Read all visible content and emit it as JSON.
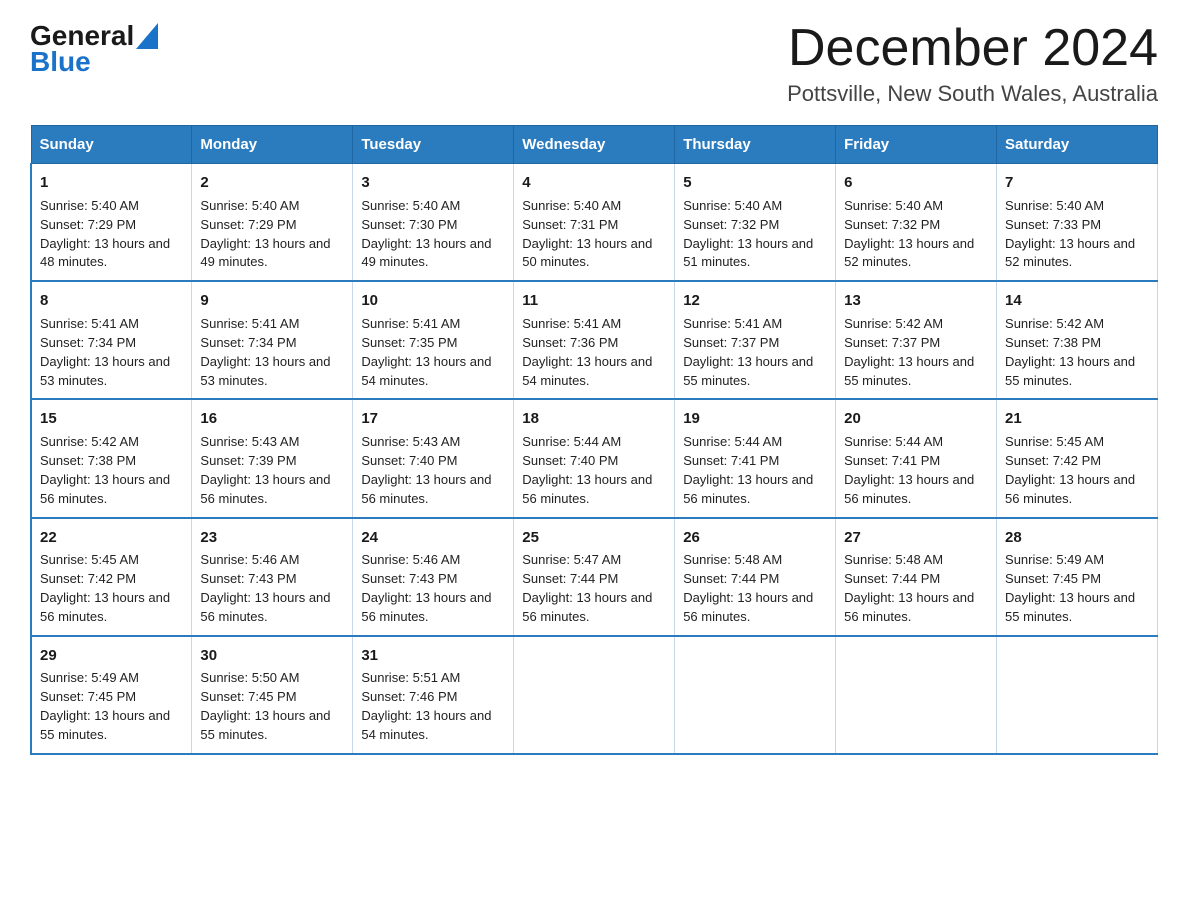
{
  "header": {
    "logo_general": "General",
    "logo_blue": "Blue",
    "title": "December 2024",
    "subtitle": "Pottsville, New South Wales, Australia"
  },
  "days_of_week": [
    "Sunday",
    "Monday",
    "Tuesday",
    "Wednesday",
    "Thursday",
    "Friday",
    "Saturday"
  ],
  "weeks": [
    [
      {
        "day": 1,
        "sunrise": "5:40 AM",
        "sunset": "7:29 PM",
        "daylight": "13 hours and 48 minutes."
      },
      {
        "day": 2,
        "sunrise": "5:40 AM",
        "sunset": "7:29 PM",
        "daylight": "13 hours and 49 minutes."
      },
      {
        "day": 3,
        "sunrise": "5:40 AM",
        "sunset": "7:30 PM",
        "daylight": "13 hours and 49 minutes."
      },
      {
        "day": 4,
        "sunrise": "5:40 AM",
        "sunset": "7:31 PM",
        "daylight": "13 hours and 50 minutes."
      },
      {
        "day": 5,
        "sunrise": "5:40 AM",
        "sunset": "7:32 PM",
        "daylight": "13 hours and 51 minutes."
      },
      {
        "day": 6,
        "sunrise": "5:40 AM",
        "sunset": "7:32 PM",
        "daylight": "13 hours and 52 minutes."
      },
      {
        "day": 7,
        "sunrise": "5:40 AM",
        "sunset": "7:33 PM",
        "daylight": "13 hours and 52 minutes."
      }
    ],
    [
      {
        "day": 8,
        "sunrise": "5:41 AM",
        "sunset": "7:34 PM",
        "daylight": "13 hours and 53 minutes."
      },
      {
        "day": 9,
        "sunrise": "5:41 AM",
        "sunset": "7:34 PM",
        "daylight": "13 hours and 53 minutes."
      },
      {
        "day": 10,
        "sunrise": "5:41 AM",
        "sunset": "7:35 PM",
        "daylight": "13 hours and 54 minutes."
      },
      {
        "day": 11,
        "sunrise": "5:41 AM",
        "sunset": "7:36 PM",
        "daylight": "13 hours and 54 minutes."
      },
      {
        "day": 12,
        "sunrise": "5:41 AM",
        "sunset": "7:37 PM",
        "daylight": "13 hours and 55 minutes."
      },
      {
        "day": 13,
        "sunrise": "5:42 AM",
        "sunset": "7:37 PM",
        "daylight": "13 hours and 55 minutes."
      },
      {
        "day": 14,
        "sunrise": "5:42 AM",
        "sunset": "7:38 PM",
        "daylight": "13 hours and 55 minutes."
      }
    ],
    [
      {
        "day": 15,
        "sunrise": "5:42 AM",
        "sunset": "7:38 PM",
        "daylight": "13 hours and 56 minutes."
      },
      {
        "day": 16,
        "sunrise": "5:43 AM",
        "sunset": "7:39 PM",
        "daylight": "13 hours and 56 minutes."
      },
      {
        "day": 17,
        "sunrise": "5:43 AM",
        "sunset": "7:40 PM",
        "daylight": "13 hours and 56 minutes."
      },
      {
        "day": 18,
        "sunrise": "5:44 AM",
        "sunset": "7:40 PM",
        "daylight": "13 hours and 56 minutes."
      },
      {
        "day": 19,
        "sunrise": "5:44 AM",
        "sunset": "7:41 PM",
        "daylight": "13 hours and 56 minutes."
      },
      {
        "day": 20,
        "sunrise": "5:44 AM",
        "sunset": "7:41 PM",
        "daylight": "13 hours and 56 minutes."
      },
      {
        "day": 21,
        "sunrise": "5:45 AM",
        "sunset": "7:42 PM",
        "daylight": "13 hours and 56 minutes."
      }
    ],
    [
      {
        "day": 22,
        "sunrise": "5:45 AM",
        "sunset": "7:42 PM",
        "daylight": "13 hours and 56 minutes."
      },
      {
        "day": 23,
        "sunrise": "5:46 AM",
        "sunset": "7:43 PM",
        "daylight": "13 hours and 56 minutes."
      },
      {
        "day": 24,
        "sunrise": "5:46 AM",
        "sunset": "7:43 PM",
        "daylight": "13 hours and 56 minutes."
      },
      {
        "day": 25,
        "sunrise": "5:47 AM",
        "sunset": "7:44 PM",
        "daylight": "13 hours and 56 minutes."
      },
      {
        "day": 26,
        "sunrise": "5:48 AM",
        "sunset": "7:44 PM",
        "daylight": "13 hours and 56 minutes."
      },
      {
        "day": 27,
        "sunrise": "5:48 AM",
        "sunset": "7:44 PM",
        "daylight": "13 hours and 56 minutes."
      },
      {
        "day": 28,
        "sunrise": "5:49 AM",
        "sunset": "7:45 PM",
        "daylight": "13 hours and 55 minutes."
      }
    ],
    [
      {
        "day": 29,
        "sunrise": "5:49 AM",
        "sunset": "7:45 PM",
        "daylight": "13 hours and 55 minutes."
      },
      {
        "day": 30,
        "sunrise": "5:50 AM",
        "sunset": "7:45 PM",
        "daylight": "13 hours and 55 minutes."
      },
      {
        "day": 31,
        "sunrise": "5:51 AM",
        "sunset": "7:46 PM",
        "daylight": "13 hours and 54 minutes."
      },
      null,
      null,
      null,
      null
    ]
  ]
}
